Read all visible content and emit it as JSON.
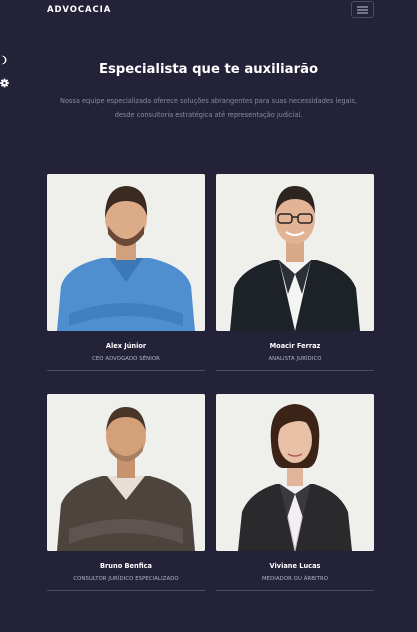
{
  "navbar": {
    "brand": "ADVOCACIA"
  },
  "icons": {
    "menu": "hamburger-menu-icon",
    "theme": "moon-icon",
    "settings": "gear-icon"
  },
  "hero": {
    "title": "Especialista que te auxiliarão",
    "subtitle_line1": "Nossa equipe especializada oferece soluções abrangentes para suas necessidades legais,",
    "subtitle_line2": "desde consultoria estratégica até representação judicial."
  },
  "team": [
    {
      "name": "Alex Júnior",
      "role": "CEO ADVOGADO SÊNIOR"
    },
    {
      "name": "Moacir Ferraz",
      "role": "ANALISTA JURÍDICO"
    },
    {
      "name": "Bruno Benfica",
      "role": "CONSULTOR JURÍDICO ESPECIALIZADO"
    },
    {
      "name": "Viviane Lucas",
      "role": "MEDIADOR OU ÁRBITRO"
    }
  ],
  "colors": {
    "background": "#232238",
    "heading": "#ffffff",
    "muted_text": "#8a8aa4",
    "divider": "#4b4a63",
    "photo_background": "#efefec"
  }
}
